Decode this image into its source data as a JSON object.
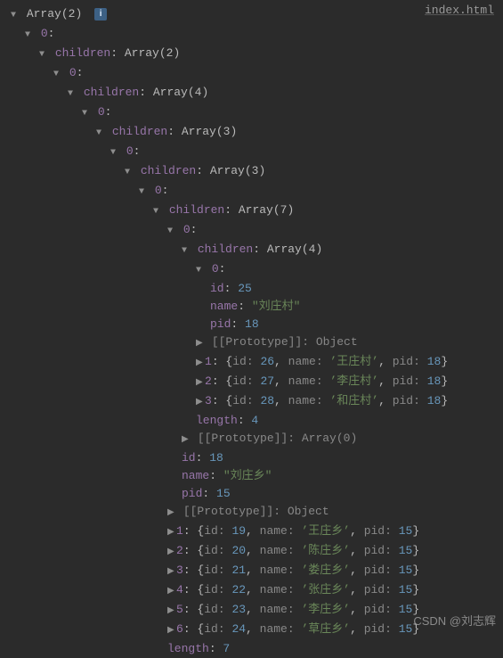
{
  "source_label": "index.html",
  "watermark": "CSDN @刘志辉",
  "labels": {
    "array": "Array",
    "children": "children",
    "length": "length",
    "prototype": "[[Prototype]]",
    "id": "id",
    "name": "name",
    "pid": "pid",
    "object": "Object"
  },
  "root_count": 2,
  "l2_children_count": 2,
  "l4_children_count": 4,
  "l6_children_count": 3,
  "l8_children_count": 3,
  "l10_children_count": 7,
  "l12_children_count": 4,
  "level14": {
    "id": 25,
    "name": "刘庄村",
    "pid": 18
  },
  "l12_items": [
    {
      "idx": 1,
      "id": 26,
      "name": "王庄村",
      "pid": 18
    },
    {
      "idx": 2,
      "id": 27,
      "name": "李庄村",
      "pid": 18
    },
    {
      "idx": 3,
      "id": 28,
      "name": "和庄村",
      "pid": 18
    }
  ],
  "l12_length": 4,
  "l11_children_after_count": 0,
  "l11": {
    "id": 18,
    "name": "刘庄乡",
    "pid": 15
  },
  "l10_items": [
    {
      "idx": 1,
      "id": 19,
      "name": "王庄乡",
      "pid": 15
    },
    {
      "idx": 2,
      "id": 20,
      "name": "陈庄乡",
      "pid": 15
    },
    {
      "idx": 3,
      "id": 21,
      "name": "娄庄乡",
      "pid": 15
    },
    {
      "idx": 4,
      "id": 22,
      "name": "张庄乡",
      "pid": 15
    },
    {
      "idx": 5,
      "id": 23,
      "name": "李庄乡",
      "pid": 15
    },
    {
      "idx": 6,
      "id": 24,
      "name": "草庄乡",
      "pid": 15
    }
  ],
  "l10_length": 7
}
